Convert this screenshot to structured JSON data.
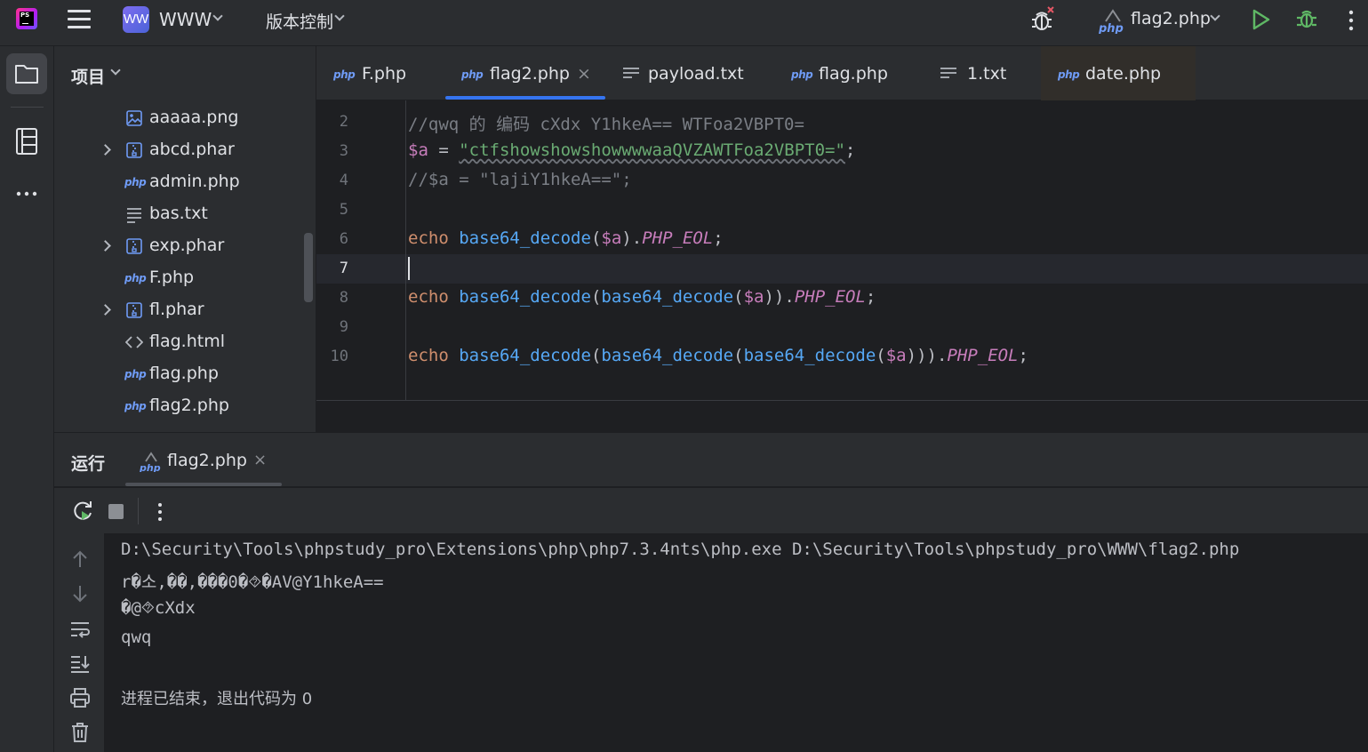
{
  "titlebar": {
    "app_logo": "PS",
    "project_badge": "WW",
    "project_name": "WWW",
    "vcs_label": "版本控制",
    "run_config": "flag2.php"
  },
  "project_panel": {
    "title": "项目",
    "items": [
      {
        "label": "aaaaa.png",
        "icon": "image-file-icon",
        "expandable": false
      },
      {
        "label": "abcd.phar",
        "icon": "archive-file-icon",
        "expandable": true
      },
      {
        "label": "admin.php",
        "icon": "php-file-icon",
        "expandable": false
      },
      {
        "label": "bas.txt",
        "icon": "text-file-icon",
        "expandable": false
      },
      {
        "label": "exp.phar",
        "icon": "archive-file-icon",
        "expandable": true
      },
      {
        "label": "F.php",
        "icon": "php-file-icon",
        "expandable": false
      },
      {
        "label": "fl.phar",
        "icon": "archive-file-icon",
        "expandable": true
      },
      {
        "label": "flag.html",
        "icon": "html-file-icon",
        "expandable": false
      },
      {
        "label": "flag.php",
        "icon": "php-file-icon",
        "expandable": false
      },
      {
        "label": "flag2.php",
        "icon": "php-file-icon",
        "expandable": false
      }
    ]
  },
  "editor": {
    "tabs": [
      {
        "label": "F.php",
        "icon": "php",
        "active": false
      },
      {
        "label": "flag2.php",
        "icon": "php",
        "active": true
      },
      {
        "label": "payload.txt",
        "icon": "text",
        "active": false
      },
      {
        "label": "flag.php",
        "icon": "php",
        "active": false
      },
      {
        "label": "1.txt",
        "icon": "text",
        "active": false
      },
      {
        "label": "date.php",
        "icon": "php",
        "active": false
      }
    ],
    "php_icon_text": "php",
    "close_glyph": "×",
    "line_numbers": [
      "2",
      "3",
      "4",
      "5",
      "6",
      "7",
      "8",
      "9",
      "10"
    ],
    "current_line": "7",
    "code": {
      "l2_comment": "//qwq 的 编码 cXdx Y1hkeA== WTFoa2VBPT0=",
      "l3_var": "$a",
      "l3_eq": " = ",
      "l3_string": "\"ctfshowshowshowwwwaaQVZAWTFoa2VBPT0=\"",
      "l3_semi": ";",
      "l4_comment": "//$a = \"lajiY1hkeA==\";",
      "echo": "echo",
      "fn": "base64_decode",
      "lparen": "(",
      "rparen": ")",
      "dot": ".",
      "eol": "PHP_EOL",
      "var": "$a",
      "semi": ";"
    }
  },
  "run_panel": {
    "title": "运行",
    "tab_name": "flag2.php",
    "close_glyph": "×",
    "output": [
      "D:\\Security\\Tools\\phpstudy_pro\\Extensions\\php\\php7.3.4nts\\php.exe D:\\Security\\Tools\\phpstudy_pro\\WWW\\flag2.php",
      "r�소,��,���0�⯑�AV@Y1hkeA==",
      "�@⯑cXdx",
      "qwq",
      "进程已结束，退出代码为 0"
    ]
  },
  "colors": {
    "accent": "#3574f0",
    "run_green": "#5fb865",
    "debug_red": "#e55765"
  }
}
